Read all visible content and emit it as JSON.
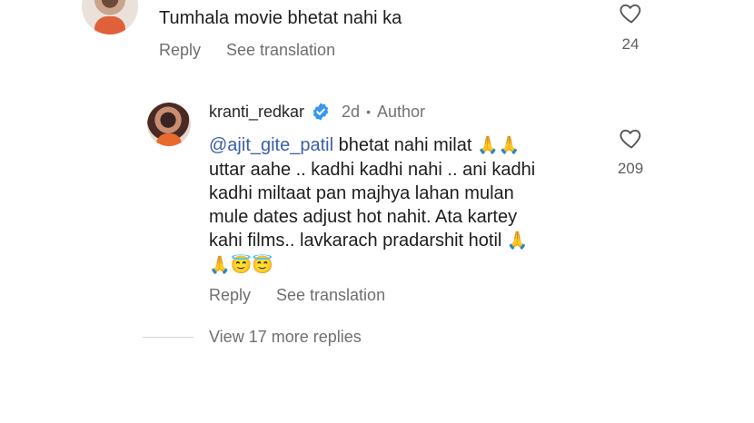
{
  "comment1": {
    "text": "Tumhala movie bhetat nahi ka",
    "reply_label": "Reply",
    "translate_label": "See translation",
    "like_count": "24"
  },
  "comment2": {
    "username": "kranti_redkar",
    "verified_icon": "verified-badge-icon",
    "age": "2d",
    "separator": "•",
    "role": "Author",
    "mention": "@ajit_gite_patil",
    "line1_text": " bhetat nahi milat ",
    "line2": "uttar aahe .. kadhi kadhi nahi .. ani kadhi",
    "line3": "kadhi miltaat pan majhya lahan mulan",
    "line4": "mule dates adjust hot nahit. Ata kartey",
    "line5_text": "kahi films.. lavkarach pradarshit hotil ",
    "emoji_pray": "🙏",
    "emoji_halo": "😇",
    "reply_label": "Reply",
    "translate_label": "See translation",
    "like_count": "209"
  },
  "view_more_label": "View 17 more replies",
  "colors": {
    "mention": "#3a5fa8",
    "verified": "#3897f0",
    "muted": "#737373"
  }
}
